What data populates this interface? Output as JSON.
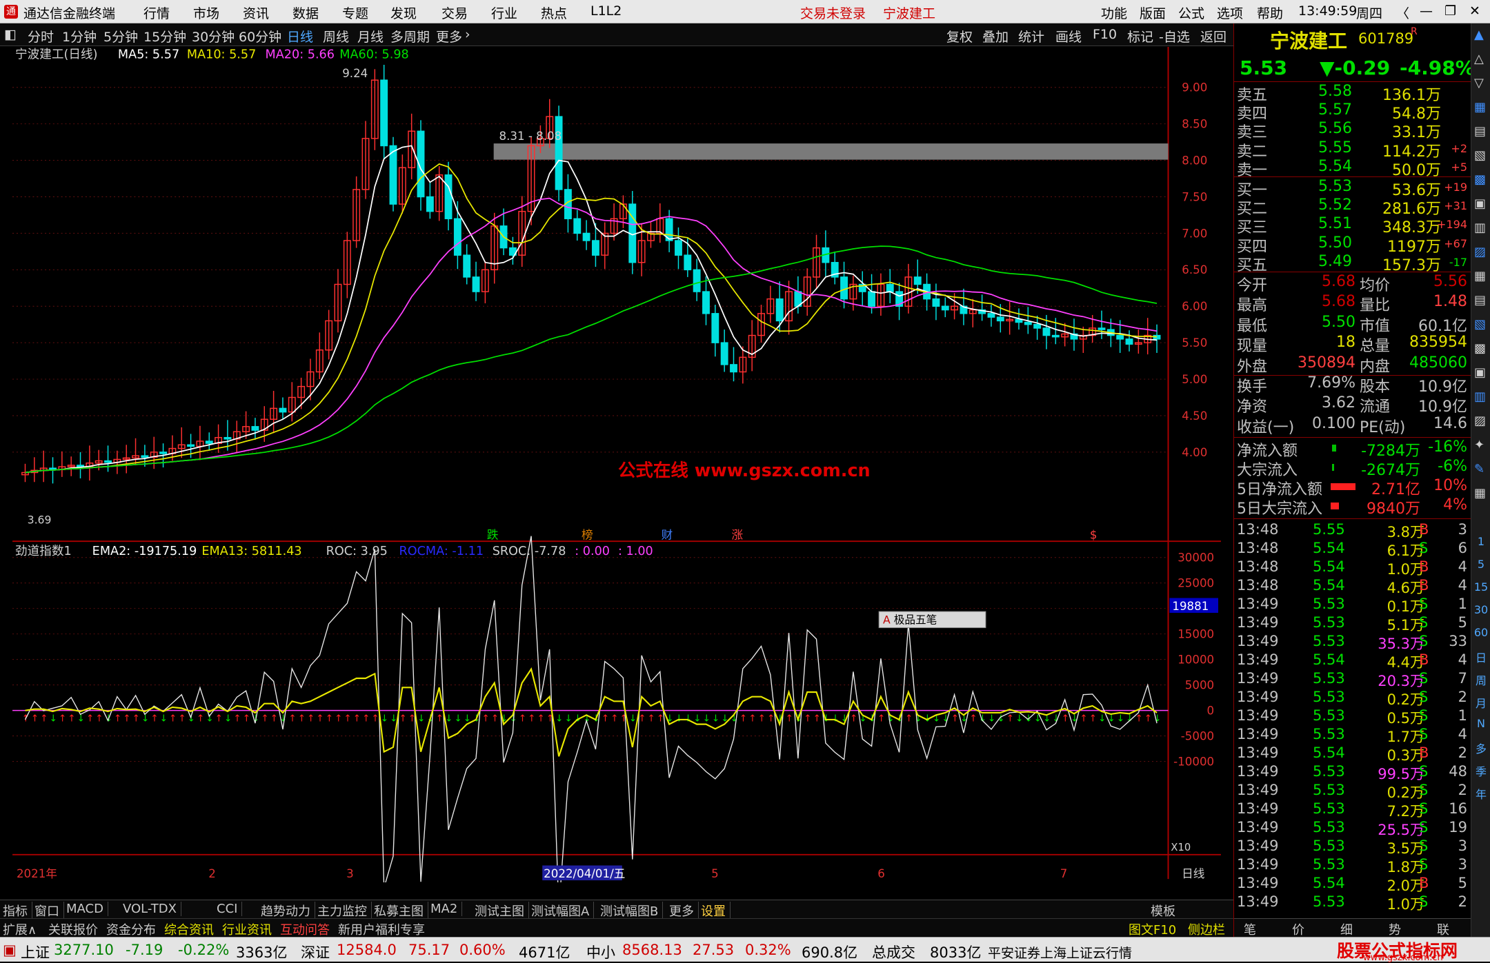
{
  "app": {
    "title": "通达信金融终端",
    "menus": [
      "行情",
      "市场",
      "资讯",
      "数据",
      "专题",
      "发现",
      "交易",
      "行业",
      "热点",
      "L1L2"
    ],
    "login_status": "交易未登录",
    "stock_tab": "宁波建工",
    "right_menus": [
      "功能",
      "版面",
      "公式",
      "选项",
      "帮助"
    ],
    "time": "13:49:59",
    "weekday": "周四"
  },
  "toolbar": {
    "periods": [
      "分时",
      "1分钟",
      "5分钟",
      "15分钟",
      "30分钟",
      "60分钟",
      "日线",
      "周线",
      "月线",
      "多周期",
      "更多"
    ],
    "active": "日线",
    "tools": [
      "复权",
      "叠加",
      "统计",
      "画线",
      "F10",
      "标记",
      "-自选",
      "返回"
    ]
  },
  "main_chart": {
    "stock_label": "宁波建工(日线)",
    "ma5": "MA5: 5.57",
    "ma10": "MA10: 5.57",
    "ma20": "MA20: 5.66",
    "ma60": "MA60: 5.98",
    "high_label": "9.24",
    "low_label": "3.69",
    "range_label": "8.31 - 8.08",
    "y_ticks": [
      "9.00",
      "8.50",
      "8.00",
      "7.50",
      "7.00",
      "6.50",
      "6.00",
      "5.50",
      "5.00",
      "4.50",
      "4.00"
    ],
    "watermark": "公式在线  www.gszx.com.cn",
    "event_markers": [
      "跌",
      "榜",
      "财",
      "涨"
    ],
    "event_marker_s": "$"
  },
  "indicator": {
    "name": "劲道指数1",
    "ema2": "EMA2: -19175.19",
    "ema13": "EMA13: 5811.43",
    "roc": "ROC: 3.95",
    "rocma": "ROCMA: -1.11",
    "sroc": "SROC: -7.78",
    "p0": ": 0.00",
    "p1": ": 1.00",
    "y_ticks": [
      "30000",
      "25000",
      "20000",
      "15000",
      "10000",
      "5000",
      "0",
      "-5000",
      "-10000"
    ],
    "cursor_value": "19881",
    "x10": "X10",
    "popup": "极品五笔"
  },
  "dates": {
    "labels": [
      "2021年",
      "2",
      "3",
      "2022/04/01/五",
      "5",
      "6",
      "7"
    ],
    "period": "日线"
  },
  "bottom_tabs": [
    "指标",
    "窗口",
    "MACD",
    "VOL-TDX",
    "CCI",
    "趋势动力",
    "主力监控",
    "私募主图",
    "MA2",
    "测试主图",
    "测试幅图A",
    "测试幅图B",
    "更多",
    "设置"
  ],
  "bottom_tab_right": "模板",
  "bottom_tabs2": [
    "扩展∧",
    "关联报价",
    "资金分布",
    "综合资讯",
    "行业资讯",
    "互动问答",
    "新用户福利专享"
  ],
  "bottom_right2": [
    "图文F10",
    "侧边栏《"
  ],
  "quote": {
    "name": "宁波建工",
    "code": "601789",
    "flag": "R",
    "price": "5.53",
    "change": "▼-0.29",
    "pct": "-4.98%",
    "sell": [
      [
        "卖五",
        "5.58",
        "136.1万",
        ""
      ],
      [
        "卖四",
        "5.57",
        "54.8万",
        ""
      ],
      [
        "卖三",
        "5.56",
        "33.1万",
        ""
      ],
      [
        "卖二",
        "5.55",
        "114.2万",
        "+2"
      ],
      [
        "卖一",
        "5.54",
        "50.0万",
        "+5"
      ]
    ],
    "buy": [
      [
        "买一",
        "5.53",
        "53.6万",
        "+19"
      ],
      [
        "买二",
        "5.52",
        "281.6万",
        "+31"
      ],
      [
        "买三",
        "5.51",
        "348.3万",
        "+194"
      ],
      [
        "买四",
        "5.50",
        "1197万",
        "+67"
      ],
      [
        "买五",
        "5.49",
        "157.3万",
        "-17"
      ]
    ],
    "stats": [
      [
        "今开",
        "5.68",
        "均价",
        "5.56"
      ],
      [
        "最高",
        "5.68",
        "量比",
        "1.48"
      ],
      [
        "最低",
        "5.50",
        "市值",
        "60.1亿"
      ],
      [
        "现量",
        "18",
        "总量",
        "835954"
      ],
      [
        "外盘",
        "350894",
        "内盘",
        "485060"
      ],
      [
        "换手",
        "7.69%",
        "股本",
        "10.9亿"
      ],
      [
        "净资",
        "3.62",
        "流通",
        "10.9亿"
      ],
      [
        "收益(一)",
        "0.100",
        "PE(动)",
        "14.6"
      ]
    ],
    "flows": [
      [
        "净流入额",
        "-7284万",
        "-16%"
      ],
      [
        "大宗流入",
        "-2674万",
        "-6%"
      ],
      [
        "5日净流入额",
        "2.71亿",
        "10%"
      ],
      [
        "5日大宗流入",
        "9840万",
        "4%"
      ]
    ],
    "ticks": [
      [
        "13:48",
        "5.55",
        "3.8万",
        "B",
        "3"
      ],
      [
        "13:48",
        "5.54",
        "6.1万",
        "S",
        "6"
      ],
      [
        "13:48",
        "5.54",
        "1.0万",
        "B",
        "4"
      ],
      [
        "13:48",
        "5.54",
        "4.6万",
        "B",
        "4"
      ],
      [
        "13:49",
        "5.53",
        "0.1万",
        "S",
        "1"
      ],
      [
        "13:49",
        "5.53",
        "5.1万",
        "S",
        "5"
      ],
      [
        "13:49",
        "5.53",
        "35.3万",
        "S",
        "33"
      ],
      [
        "13:49",
        "5.54",
        "4.4万",
        "B",
        "4"
      ],
      [
        "13:49",
        "5.53",
        "20.3万",
        "S",
        "7"
      ],
      [
        "13:49",
        "5.53",
        "0.2万",
        "S",
        "2"
      ],
      [
        "13:49",
        "5.53",
        "0.5万",
        "S",
        "1"
      ],
      [
        "13:49",
        "5.53",
        "1.7万",
        "S",
        "4"
      ],
      [
        "13:49",
        "5.54",
        "0.3万",
        "B",
        "2"
      ],
      [
        "13:49",
        "5.53",
        "99.5万",
        "S",
        "48"
      ],
      [
        "13:49",
        "5.53",
        "0.2万",
        "S",
        "2"
      ],
      [
        "13:49",
        "5.53",
        "7.2万",
        "S",
        "16"
      ],
      [
        "13:49",
        "5.53",
        "25.5万",
        "S",
        "19"
      ],
      [
        "13:49",
        "5.53",
        "3.5万",
        "S",
        "3"
      ],
      [
        "13:49",
        "5.53",
        "1.8万",
        "S",
        "3"
      ],
      [
        "13:49",
        "5.54",
        "2.0万",
        "B",
        "5"
      ],
      [
        "13:49",
        "5.53",
        "1.0万",
        "S",
        "2"
      ]
    ],
    "bottom_tabs": [
      "笔",
      "价",
      "细",
      "势",
      "联"
    ]
  },
  "side_icons": [
    "1",
    "5",
    "15",
    "30",
    "60",
    "日",
    "周",
    "月",
    "N",
    "多",
    "季",
    "年"
  ],
  "status": {
    "sh": "上证",
    "sh_val": "3277.10",
    "sh_chg": "-7.19",
    "sh_pct": "-0.22%",
    "sh_amt": "3363亿",
    "sz": "深证",
    "sz_val": "12584.0",
    "sz_chg": "75.17",
    "sz_pct": "0.60%",
    "sz_amt": "4671亿",
    "zx": "中小",
    "zx_val": "8568.13",
    "zx_chg": "27.53",
    "zx_pct": "0.32%",
    "zx_amt": "690.8亿",
    "total_label": "总成交",
    "total": "8033亿",
    "broker": "平安证券上海上证云行情",
    "logo": "股票公式指标网",
    "logo_url": "www.gszx.com.cn"
  }
}
